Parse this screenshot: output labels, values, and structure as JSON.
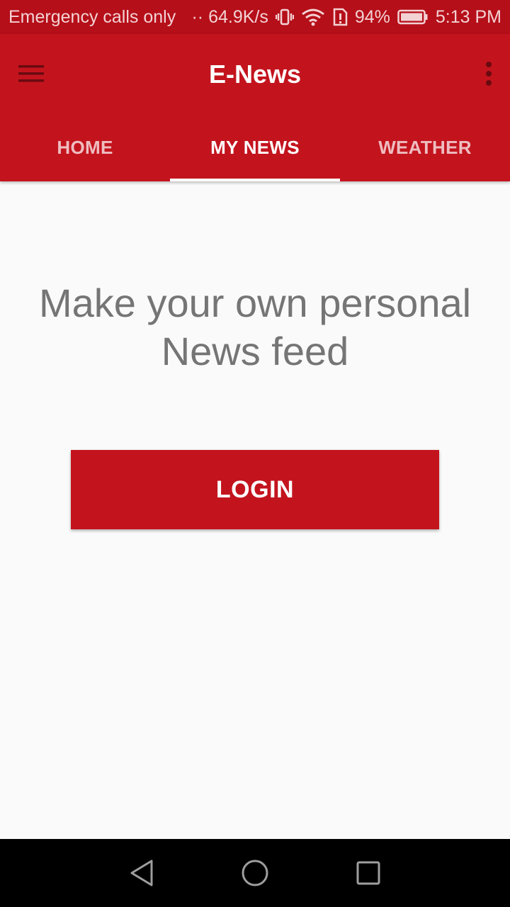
{
  "status_bar": {
    "carrier_text": "Emergency calls only",
    "network_speed": "·· 64.9K/s",
    "battery_percent": "94%",
    "time": "5:13 PM",
    "icons": [
      "vibrate-icon",
      "wifi-icon",
      "sim-alert-icon",
      "battery-icon"
    ]
  },
  "app_bar": {
    "title": "E-News",
    "menu_icon": "hamburger-menu-icon",
    "overflow_icon": "more-vert-icon"
  },
  "tabs": [
    {
      "label": "HOME",
      "active": false
    },
    {
      "label": "MY NEWS",
      "active": true
    },
    {
      "label": "WEATHER",
      "active": false
    }
  ],
  "main": {
    "headline": "Make your own personal News feed",
    "login_label": "LOGIN"
  },
  "nav_bar": {
    "icons": [
      "back-icon",
      "home-icon",
      "recents-icon"
    ]
  },
  "colors": {
    "status_bar": "#b50f19",
    "primary": "#c3141e",
    "background": "#fafafa",
    "headline_text": "#757575"
  }
}
